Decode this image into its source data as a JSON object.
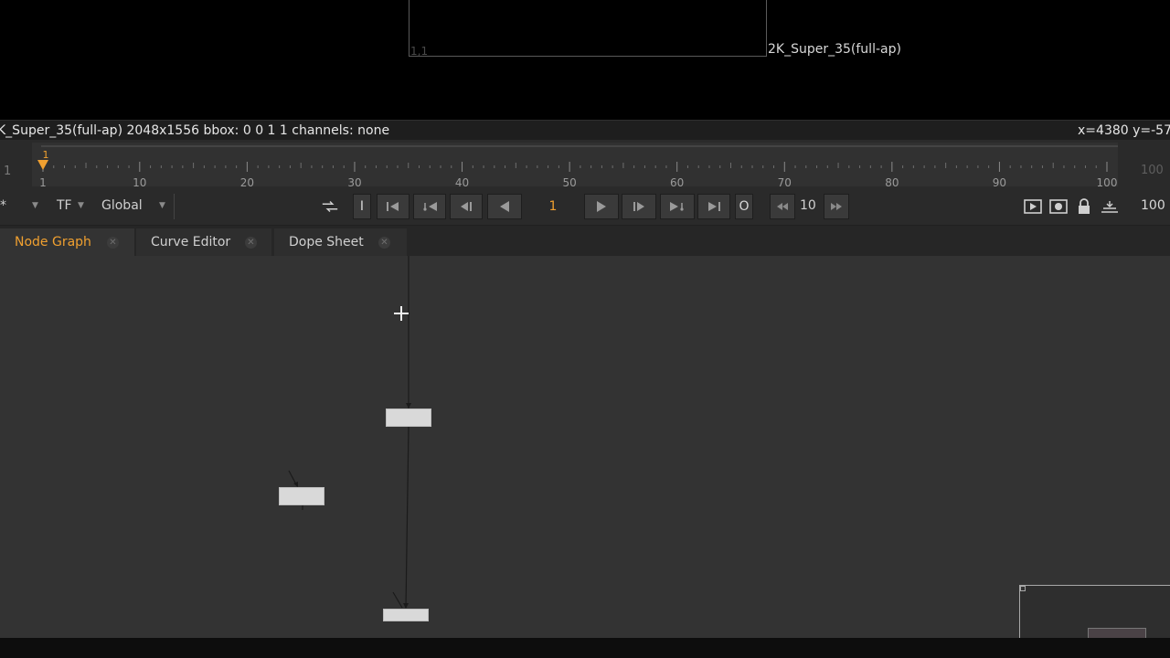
{
  "viewer": {
    "corner_coord": "1,1",
    "format_label": "2K_Super_35(full-ap)"
  },
  "infobar": {
    "left_text": "K_Super_35(full-ap) 2048x1556  bbox: 0 0 1 1 channels: none",
    "right_text": "x=4380 y=-57"
  },
  "timeline": {
    "start_frame": "1",
    "end_frame": "100",
    "current_frame_marker": "1",
    "range": [
      1,
      100
    ],
    "ticks": [
      "1",
      "10",
      "20",
      "30",
      "40",
      "50",
      "60",
      "70",
      "80",
      "90",
      "100"
    ]
  },
  "transport": {
    "fps_field": "*",
    "tf_label": "TF",
    "global_label": "Global",
    "in_label": "I",
    "out_label": "O",
    "current_frame": "1",
    "increment": "10",
    "end_frame": "100"
  },
  "tabs": [
    {
      "label": "Node Graph",
      "active": true
    },
    {
      "label": "Curve Editor",
      "active": false
    },
    {
      "label": "Dope Sheet",
      "active": false
    }
  ],
  "colors": {
    "accent": "#f0a030",
    "background": "#333333"
  }
}
